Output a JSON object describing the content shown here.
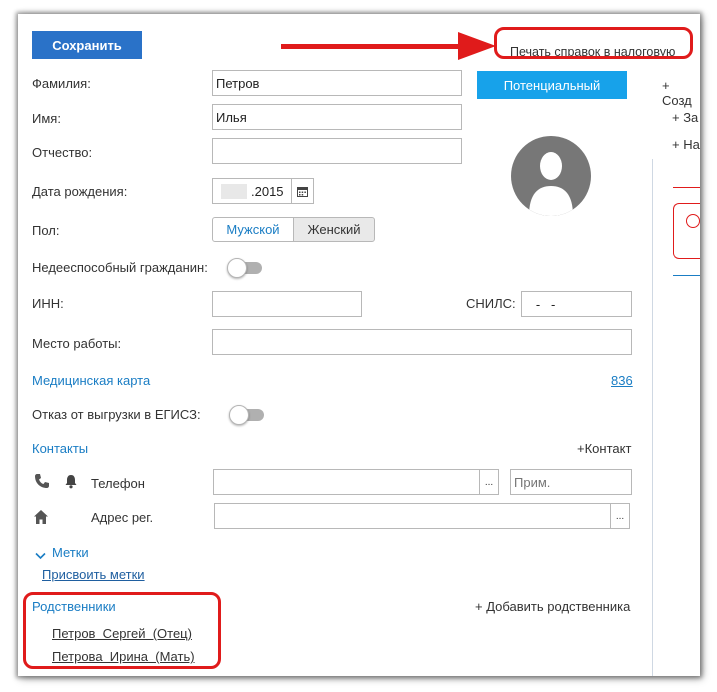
{
  "toolbar": {
    "save_label": "Сохранить",
    "print_label": "Печать справок в налоговую"
  },
  "form": {
    "last_name": {
      "label": "Фамилия:",
      "value": "Петров"
    },
    "first_name": {
      "label": "Имя:",
      "value": "Илья"
    },
    "middle_name": {
      "label": "Отчество:",
      "value": ""
    },
    "birth_date": {
      "label": "Дата рождения:",
      "value": ".2015"
    },
    "gender": {
      "label": "Пол:",
      "options": [
        "Мужской",
        "Женский"
      ],
      "selected": "Мужской"
    },
    "incapable": {
      "label": "Недееспособный гражданин:"
    },
    "inn": {
      "label": "ИНН:",
      "value": ""
    },
    "snils": {
      "label": "СНИЛС:",
      "value": "   -   -"
    },
    "workplace": {
      "label": "Место работы:",
      "value": ""
    },
    "med_card": {
      "label": "Медицинская карта",
      "value": "836"
    },
    "egisz": {
      "label": "Отказ от выгрузки в ЕГИСЗ:"
    }
  },
  "status": {
    "label": "Потенциальный"
  },
  "right_panel": {
    "items": [
      "+ Созд",
      "+ За",
      "+ На"
    ]
  },
  "contacts": {
    "title": "Контакты",
    "add_label": "+Контакт",
    "phone_label": "Телефон",
    "phone_note_placeholder": "Прим.",
    "address_label": "Адрес рег.",
    "dots": "..."
  },
  "tags": {
    "title": "Метки",
    "assign_label": "Присвоить метки"
  },
  "relatives": {
    "title": "Родственники",
    "add_label": "+ Добавить родственника",
    "items": [
      "Петров  Сергей  (Отец)",
      "Петрова  Ирина  (Мать)"
    ]
  },
  "colors": {
    "accent": "#2a72c8",
    "status": "#17a2ea",
    "link": "#1a7dc4",
    "annotation": "#e01b1b"
  }
}
